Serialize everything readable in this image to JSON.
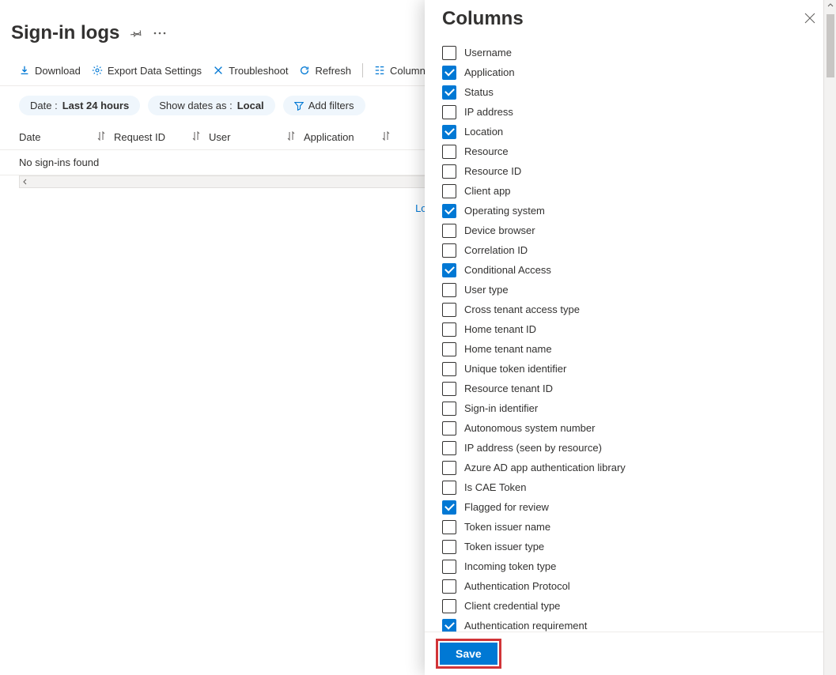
{
  "page": {
    "title": "Sign-in logs"
  },
  "toolbar": {
    "download": "Download",
    "export": "Export Data Settings",
    "troubleshoot": "Troubleshoot",
    "refresh": "Refresh",
    "columns": "Columns"
  },
  "filters": {
    "date_label": "Date : ",
    "date_value": "Last 24 hours",
    "show_label": "Show dates as : ",
    "show_value": "Local",
    "add": "Add filters"
  },
  "table": {
    "headers": [
      "Date",
      "Request ID",
      "User",
      "Application"
    ],
    "empty": "No sign-ins found"
  },
  "load_more": "Load",
  "panel": {
    "title": "Columns",
    "save": "Save",
    "options": [
      {
        "label": "Username",
        "checked": false
      },
      {
        "label": "Application",
        "checked": true
      },
      {
        "label": "Status",
        "checked": true
      },
      {
        "label": "IP address",
        "checked": false
      },
      {
        "label": "Location",
        "checked": true
      },
      {
        "label": "Resource",
        "checked": false
      },
      {
        "label": "Resource ID",
        "checked": false
      },
      {
        "label": "Client app",
        "checked": false
      },
      {
        "label": "Operating system",
        "checked": true
      },
      {
        "label": "Device browser",
        "checked": false
      },
      {
        "label": "Correlation ID",
        "checked": false
      },
      {
        "label": "Conditional Access",
        "checked": true
      },
      {
        "label": "User type",
        "checked": false
      },
      {
        "label": "Cross tenant access type",
        "checked": false
      },
      {
        "label": "Home tenant ID",
        "checked": false
      },
      {
        "label": "Home tenant name",
        "checked": false
      },
      {
        "label": "Unique token identifier",
        "checked": false
      },
      {
        "label": "Resource tenant ID",
        "checked": false
      },
      {
        "label": "Sign-in identifier",
        "checked": false
      },
      {
        "label": "Autonomous system number",
        "checked": false
      },
      {
        "label": "IP address (seen by resource)",
        "checked": false
      },
      {
        "label": "Azure AD app authentication library",
        "checked": false
      },
      {
        "label": "Is CAE Token",
        "checked": false
      },
      {
        "label": "Flagged for review",
        "checked": true
      },
      {
        "label": "Token issuer name",
        "checked": false
      },
      {
        "label": "Token issuer type",
        "checked": false
      },
      {
        "label": "Incoming token type",
        "checked": false
      },
      {
        "label": "Authentication Protocol",
        "checked": false
      },
      {
        "label": "Client credential type",
        "checked": false
      },
      {
        "label": "Authentication requirement",
        "checked": true
      }
    ]
  }
}
